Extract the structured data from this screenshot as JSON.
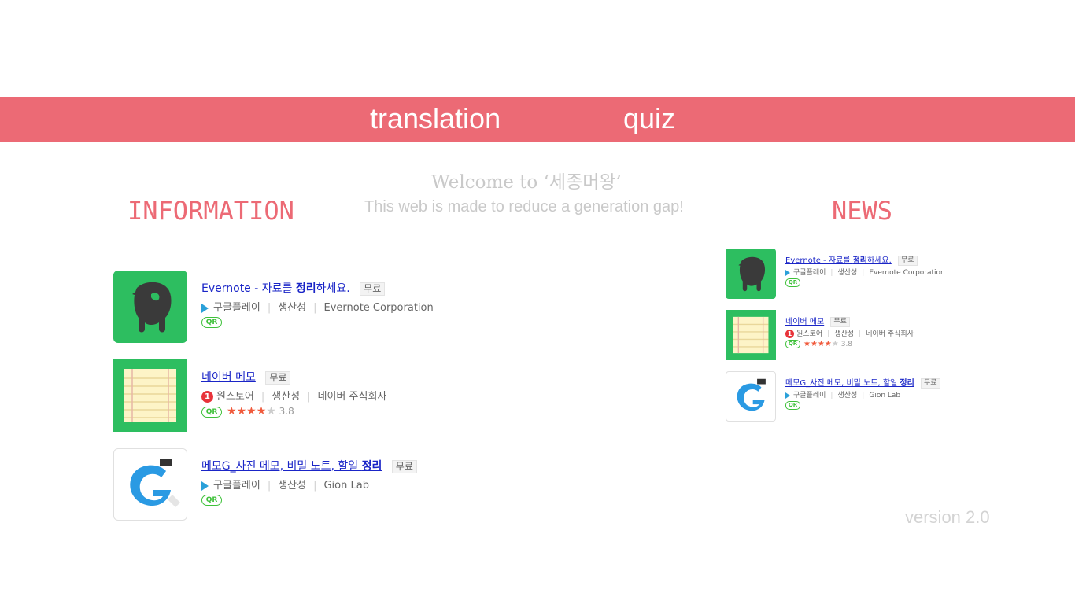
{
  "nav": {
    "items": [
      "translation",
      "quiz"
    ]
  },
  "hero": {
    "welcome": "Welcome to  ‘세종머왕’",
    "tagline": "This web is made to reduce a generation gap!"
  },
  "sections": {
    "information_title": "INFORMATION",
    "news_title": "NEWS"
  },
  "apps": [
    {
      "title_pre": "Evernote - 자료를 ",
      "title_bold": "정리",
      "title_post": "하세요.",
      "free": "무료",
      "store_icon": "google-play-icon",
      "store": "구글플레이",
      "category": "생산성",
      "developer": "Evernote Corporation",
      "qr": "QR",
      "rating_stars": 0,
      "rating": "",
      "icon": "evernote-icon"
    },
    {
      "title_pre": "네이버 메모",
      "title_bold": "",
      "title_post": "",
      "free": "무료",
      "store_icon": "onestore-icon",
      "store_badge": "1",
      "store": "원스토어",
      "category": "생산성",
      "developer": "네이버 주식회사",
      "qr": "QR",
      "rating_stars": 4,
      "rating": "3.8",
      "icon": "naver-memo-icon"
    },
    {
      "title_pre": "메모G_사진 메모, 비밀 노트, 할일 ",
      "title_bold": "정리",
      "title_post": "",
      "free": "무료",
      "store_icon": "google-play-icon",
      "store": "구글플레이",
      "category": "생산성",
      "developer": "Gion Lab",
      "qr": "QR",
      "rating_stars": 0,
      "rating": "",
      "icon": "memo-g-icon"
    }
  ],
  "footer": {
    "version": "version 2.0"
  },
  "colors": {
    "accent": "#ec6a75",
    "link": "#1a25c7",
    "evernote_green": "#2dbe60",
    "qr_green": "#3ec13a",
    "star": "#f05a3c"
  }
}
